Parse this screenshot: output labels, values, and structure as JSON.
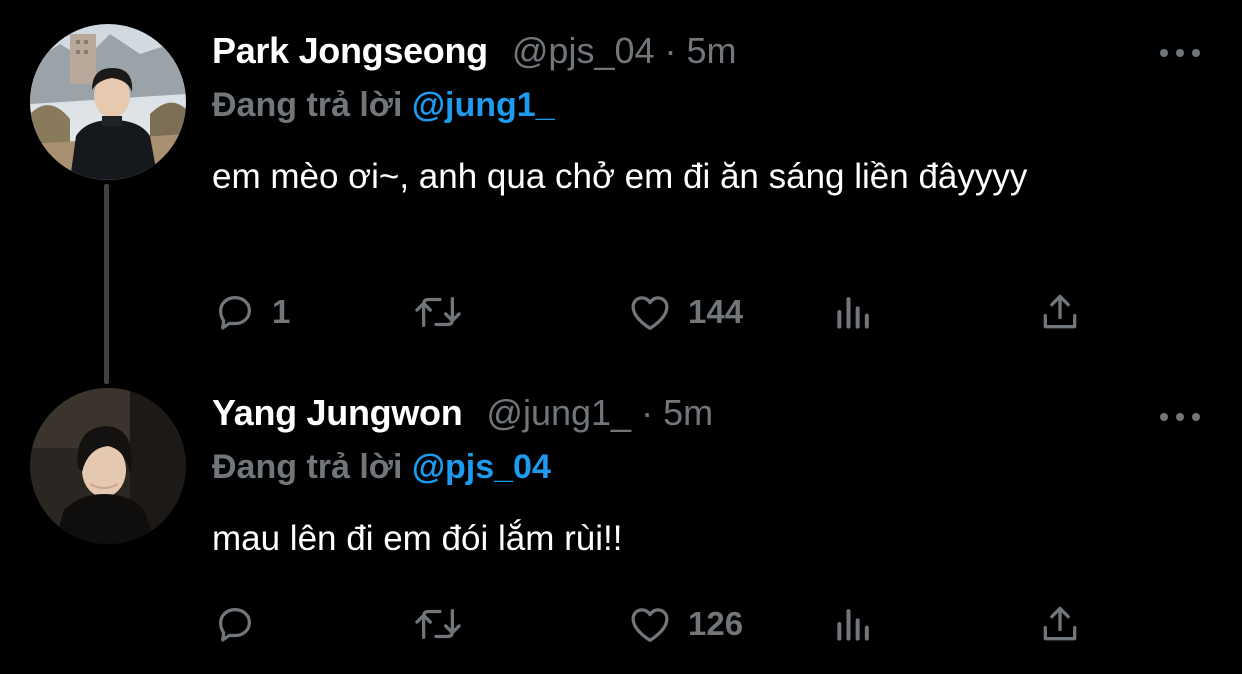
{
  "thread": {
    "tweets": [
      {
        "display_name": "Park Jongseong",
        "handle": "@pjs_04",
        "separator": "·",
        "time": "5m",
        "reply_prefix": "Đang trả lời",
        "reply_to": "@jung1_",
        "text": "em mèo ơi~, anh qua chở em đi ăn sáng liền đâyyyy",
        "reply_count": "1",
        "retweet_count": "",
        "like_count": "144"
      },
      {
        "display_name": "Yang Jungwon",
        "handle": "@jung1_",
        "separator": "·",
        "time": "5m",
        "reply_prefix": "Đang trả lời",
        "reply_to": "@pjs_04",
        "text": "mau lên đi em đói lắm rùi!!",
        "reply_count": "",
        "retweet_count": "",
        "like_count": "126"
      }
    ]
  },
  "colors": {
    "background": "#000000",
    "name": "#ffffff",
    "muted": "#71767b",
    "mention": "#1d9bf0",
    "thread_line": "#3d4247"
  },
  "icons": {
    "reply": "speech-bubble-icon",
    "retweet": "retweet-arrows-icon",
    "like": "heart-outline-icon",
    "views": "bar-chart-icon",
    "share": "upload-arrow-icon",
    "more": "three-dots-icon"
  }
}
